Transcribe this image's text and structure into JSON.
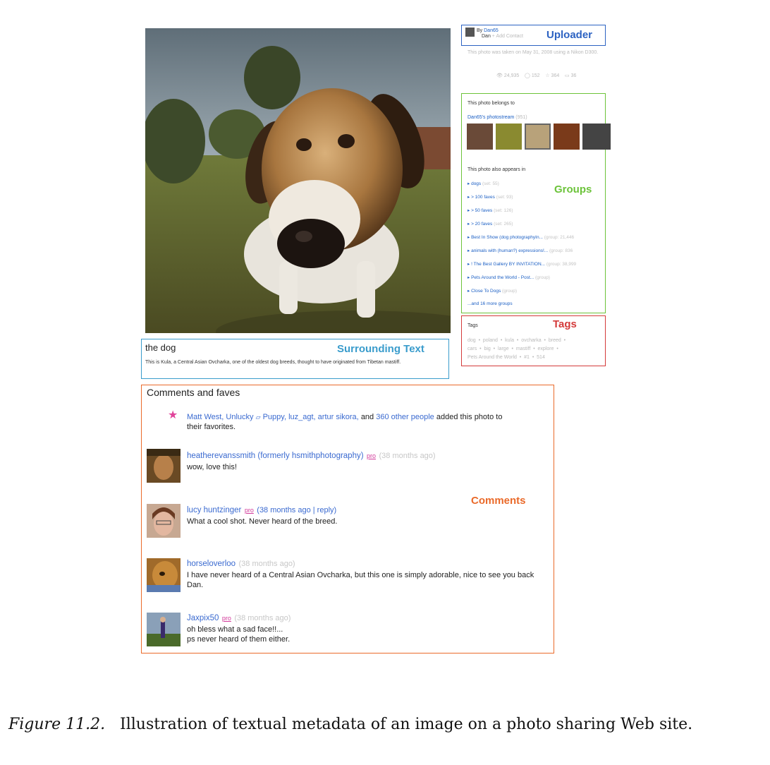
{
  "photo": {
    "alt_subject": "dog-photo"
  },
  "uploader": {
    "by": "By",
    "name": "Dan65",
    "subname": "Dan",
    "add_contact": "+ Add Contact",
    "taken_text": "This photo was taken on May 31, 2008 using a Nikon D300.",
    "stats": {
      "views": "24,935",
      "comments": "152",
      "faves": "364",
      "notes": "36"
    }
  },
  "belongs": {
    "heading": "This photo belongs to",
    "stream_link": "Dan65's photostream",
    "stream_count": "(951)"
  },
  "appears": {
    "heading": "This photo also appears in",
    "items": [
      {
        "name": "dogs",
        "meta": "(set: 55)"
      },
      {
        "name": "> 100 faves",
        "meta": "(set: 93)"
      },
      {
        "name": "> 50 faves",
        "meta": "(set: 126)"
      },
      {
        "name": "> 20 faves",
        "meta": "(set: 265)"
      },
      {
        "name": "Best In Show (dog photographyIn...",
        "meta": "(group: 21,446"
      },
      {
        "name": "animals with (human?) expressions!...",
        "meta": "(group: 836"
      },
      {
        "name": "! The Best Gallery BY INVITATION...",
        "meta": "(group: 38,999"
      },
      {
        "name": "Pets Around the World - Post...",
        "meta": "(group)"
      },
      {
        "name": "Close To Dogs",
        "meta": "(group)"
      }
    ],
    "more": "...and 16 more groups"
  },
  "tags": {
    "heading": "Tags",
    "line1": "dog  •  poland  •  kula  •  ovcharka  •  breed  •",
    "line2": "cars  •  big  •  large  •  mastiff  •  explore  •",
    "line3": "Pets Around the World  •  #1  •  514"
  },
  "surrounding": {
    "title": "the dog",
    "text": "This is Kula, a Central Asian Ovcharka, one of the oldest dog breeds, thought to have originated from Tibetan mastiff."
  },
  "comments": {
    "heading": "Comments and faves",
    "faves": {
      "names_1": "Matt West, Unlucky",
      "names_2": "Puppy, luz_agt, artur sikora,",
      "and": "and",
      "others": "360 other people",
      "suffix": "added this photo to",
      "line2": "their favorites."
    },
    "items": [
      {
        "name": "heatherevanssmith (formerly hsmithphotography)",
        "pro": "pro",
        "ago": "(38 months ago)",
        "body": "wow, love this!"
      },
      {
        "name": "lucy huntzinger",
        "pro": "pro",
        "ago": "(38 months ago | reply)",
        "body": "What a cool shot. Never heard of the breed."
      },
      {
        "name": "horseloverloo",
        "pro": "",
        "ago": "(38 months ago)",
        "body": "I have never heard of a Central Asian Ovcharka, but this one is simply adorable, nice to see you back Dan."
      },
      {
        "name": "Jaxpix50",
        "pro": "pro",
        "ago": "(38 months ago)",
        "body": "oh bless what a sad face!!...\nps never heard of them either."
      }
    ]
  },
  "labels": {
    "uploader": "Uploader",
    "groups": "Groups",
    "tags": "Tags",
    "surrounding": "Surrounding Text",
    "comments": "Comments"
  },
  "caption": {
    "figure": "Figure 11.2.",
    "text": "Illustration of textual metadata of an image on a photo sharing Web site."
  },
  "colors": {
    "uploader": "#2c62c2",
    "groups": "#6cc33a",
    "tags": "#d43a3a",
    "surrounding": "#3a9ccc",
    "comments": "#ea6a2a",
    "link": "#1b5fc4"
  }
}
